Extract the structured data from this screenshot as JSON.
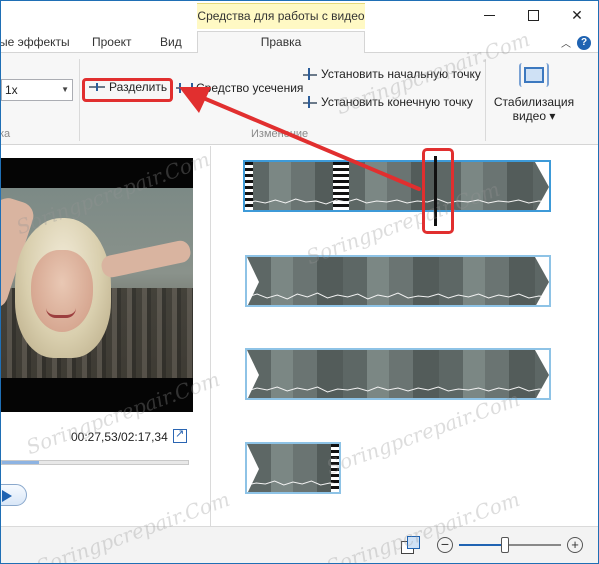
{
  "titlebar": {
    "context_tab": "Средства для работы с видео"
  },
  "tabs": [
    {
      "label": "ые эффекты"
    },
    {
      "label": "Проект"
    },
    {
      "label": "Вид"
    },
    {
      "label": "Правка",
      "active": true
    }
  ],
  "ribbon": {
    "speed_value": "1x",
    "group_left_label": "ка",
    "group_edit_label": "Изменение",
    "split_label": "Разделить",
    "trim_label": "Средство усечения",
    "set_start_label": "Установить начальную точку",
    "set_end_label": "Установить конечную точку",
    "stabilization_line1": "Стабилизация",
    "stabilization_line2": "видео ▾"
  },
  "preview": {
    "timecode": "00:27,53/02:17,34",
    "seek_progress": 0.2
  },
  "storyboard": {
    "clips": [
      {
        "id": 1,
        "selected": true
      },
      {
        "id": 2,
        "selected": false
      },
      {
        "id": 3,
        "selected": false
      },
      {
        "id": 4,
        "selected": false
      },
      {
        "id": 5,
        "selected": false
      }
    ]
  },
  "statusbar": {
    "zoom_out": "−",
    "zoom_in": "+",
    "zoom_level": 0.45
  },
  "watermark": "Soringpcrepair.Com",
  "colors": {
    "accent": "#1f63b2",
    "highlight": "#e12f2f",
    "context_tab": "#fff9c4",
    "clip_border": "#8ec3e6"
  }
}
